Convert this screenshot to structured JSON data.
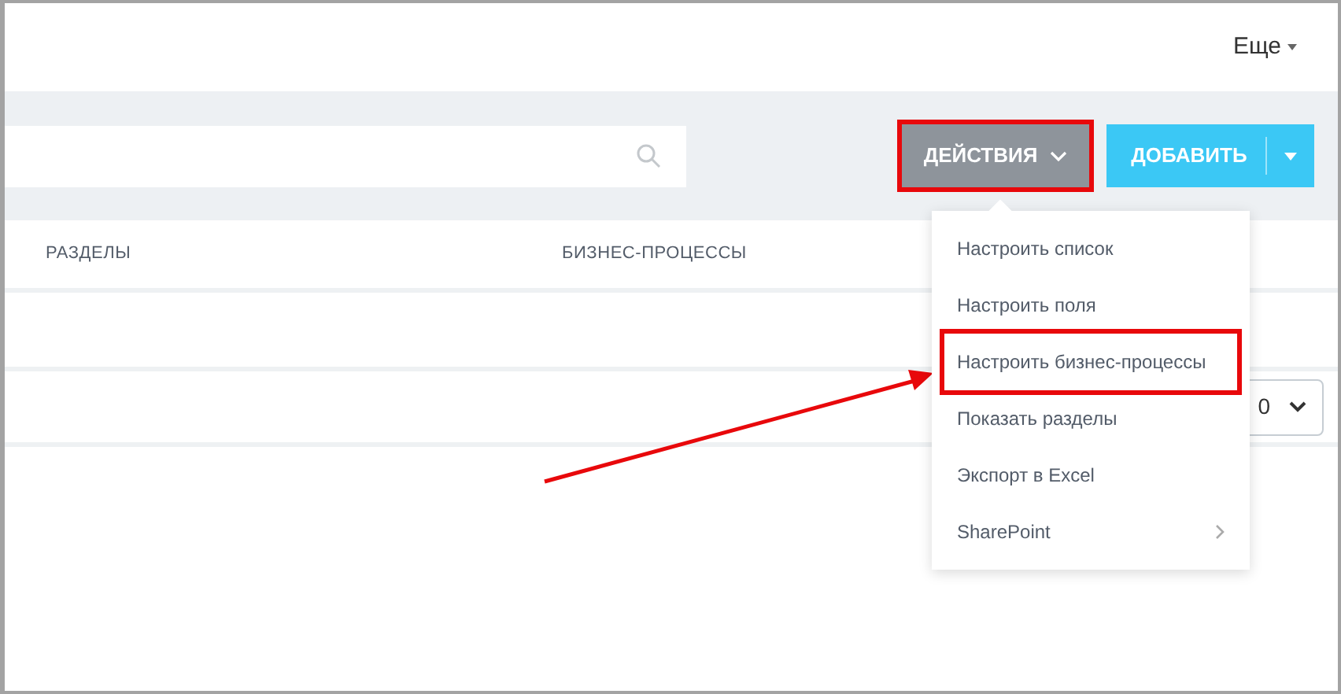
{
  "header": {
    "more_menu": "Еще"
  },
  "toolbar": {
    "actions_button": {
      "label": "ДЕЙСТВИЯ",
      "highlighted": true,
      "expanded": true
    },
    "add_button": {
      "label": "ДОБАВИТЬ"
    }
  },
  "table": {
    "columns": [
      "РАЗДЕЛЫ",
      "БИЗНЕС-ПРОЦЕССЫ"
    ],
    "page_size": "0"
  },
  "actions_menu": [
    {
      "label": "Настроить список",
      "highlighted": false,
      "submenu": false
    },
    {
      "label": "Настроить поля",
      "highlighted": false,
      "submenu": false
    },
    {
      "label": "Настроить бизнес-процессы",
      "highlighted": true,
      "submenu": false
    },
    {
      "label": "Показать разделы",
      "highlighted": false,
      "submenu": false
    },
    {
      "label": "Экспорт в Excel",
      "highlighted": false,
      "submenu": false
    },
    {
      "label": "SharePoint",
      "highlighted": false,
      "submenu": true
    }
  ]
}
